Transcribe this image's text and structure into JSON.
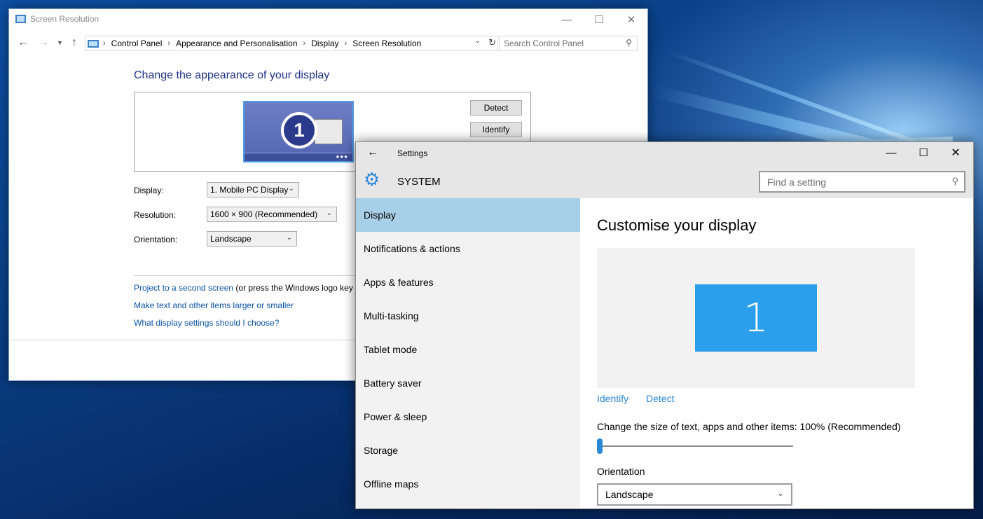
{
  "control_panel": {
    "title": "Screen Resolution",
    "breadcrumb": [
      "Control Panel",
      "Appearance and Personalisation",
      "Display",
      "Screen Resolution"
    ],
    "search_placeholder": "Search Control Panel",
    "heading": "Change the appearance of your display",
    "monitor_number": "1",
    "detect_label": "Detect",
    "identify_label": "Identify",
    "display_label": "Display:",
    "display_value": "1. Mobile PC Display",
    "resolution_label": "Resolution:",
    "resolution_value": "1600 × 900 (Recommended)",
    "orientation_label": "Orientation:",
    "orientation_value": "Landscape",
    "links": {
      "project": "Project to a second screen",
      "project_suffix": " (or press the Windows logo key",
      "larger": "Make text and other items larger or smaller",
      "which": "What display settings should I choose?"
    }
  },
  "settings": {
    "title": "Settings",
    "section": "SYSTEM",
    "search_placeholder": "Find a setting",
    "nav": [
      "Display",
      "Notifications & actions",
      "Apps & features",
      "Multi-tasking",
      "Tablet mode",
      "Battery saver",
      "Power & sleep",
      "Storage",
      "Offline maps"
    ],
    "heading": "Customise your display",
    "monitor_number": "1",
    "identify_label": "Identify",
    "detect_label": "Detect",
    "scale_label": "Change the size of text, apps and other items: 100% (Recommended)",
    "scale_value": 0,
    "orientation_label": "Orientation",
    "orientation_value": "Landscape"
  },
  "icons": {
    "back": "arrow-left-icon",
    "forward": "arrow-right-icon",
    "up": "arrow-up-icon",
    "refresh": "refresh-icon",
    "search": "search-icon",
    "gear": "gear-icon",
    "chevron": "chevron-down-icon"
  },
  "colors": {
    "accent": "#2b88d8",
    "sidebar_active": "#a8cfe8",
    "cp_heading": "#1e3287",
    "cp_link": "#0a53a8"
  }
}
